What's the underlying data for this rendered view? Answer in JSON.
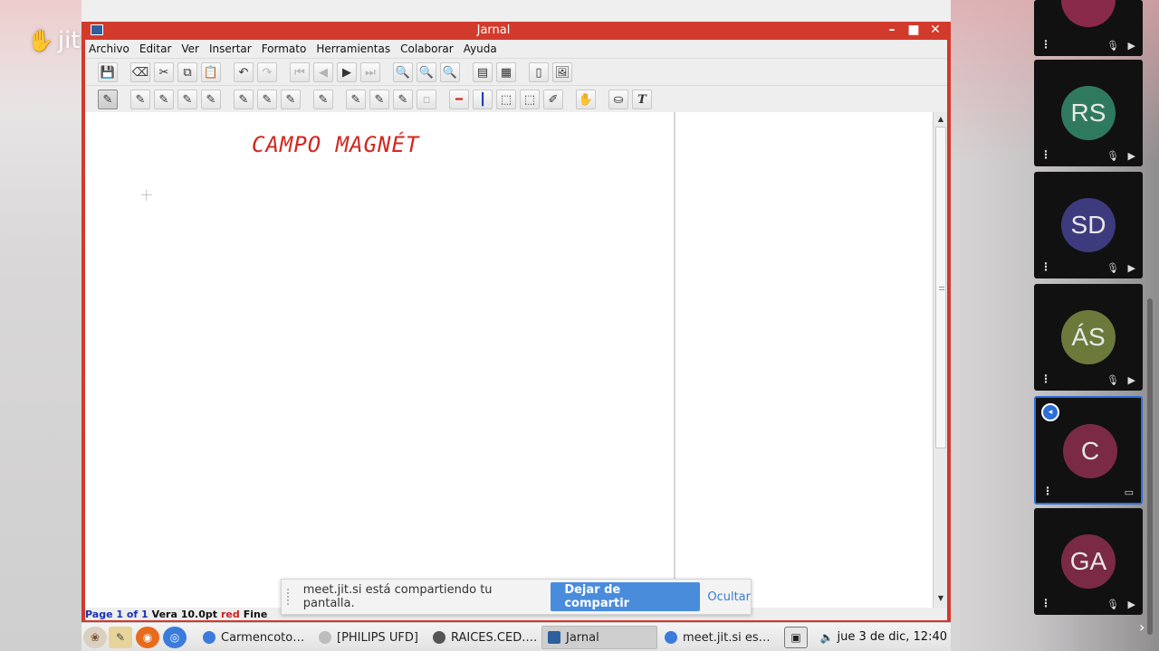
{
  "app": {
    "logo_text": "jitsi"
  },
  "window": {
    "title": "Jarnal",
    "controls": [
      "–",
      "■",
      "✕"
    ]
  },
  "menu": [
    "Archivo",
    "Editar",
    "Ver",
    "Insertar",
    "Formato",
    "Herramientas",
    "Colaborar",
    "Ayuda"
  ],
  "canvas": {
    "handwriting_text": "CAMPO MAGNÉT",
    "ink_color": "#d3281e"
  },
  "status": {
    "page": "Page 1 of 1",
    "font": "Vera 10.0pt",
    "color": "red",
    "width": "Fine"
  },
  "share_bar": {
    "message": "meet.jit.si está compartiendo tu pantalla.",
    "stop_label": "Dejar de compartir",
    "hide_label": "Ocultar"
  },
  "taskbar": {
    "tasks": [
      {
        "label": "Carmencoto…",
        "icon_color": "#3b7bdc"
      },
      {
        "label": "[PHILIPS UFD]",
        "icon_color": "#9a9a9a"
      },
      {
        "label": "RAICES.CED.…",
        "icon_color": "#555555"
      },
      {
        "label": "Jarnal",
        "icon_color": "#2c5f9e"
      },
      {
        "label": "meet.jit.si es…",
        "icon_color": "#3b7bdc"
      }
    ],
    "clock": "jue 3 de dic, 12:40"
  },
  "participants": [
    {
      "initials": "",
      "color": "#8a2a4a"
    },
    {
      "initials": "RS",
      "color": "#2f7a5f"
    },
    {
      "initials": "SD",
      "color": "#3d3a7e"
    },
    {
      "initials": "ÁS",
      "color": "#6b7a3a"
    },
    {
      "initials": "C",
      "color": "#7a2a44"
    },
    {
      "initials": "GA",
      "color": "#7a2a44"
    }
  ],
  "colors": {
    "window_frame": "#d23a2c",
    "share_button": "#4a8cdc",
    "active_speaker": "#2b6fd6"
  }
}
